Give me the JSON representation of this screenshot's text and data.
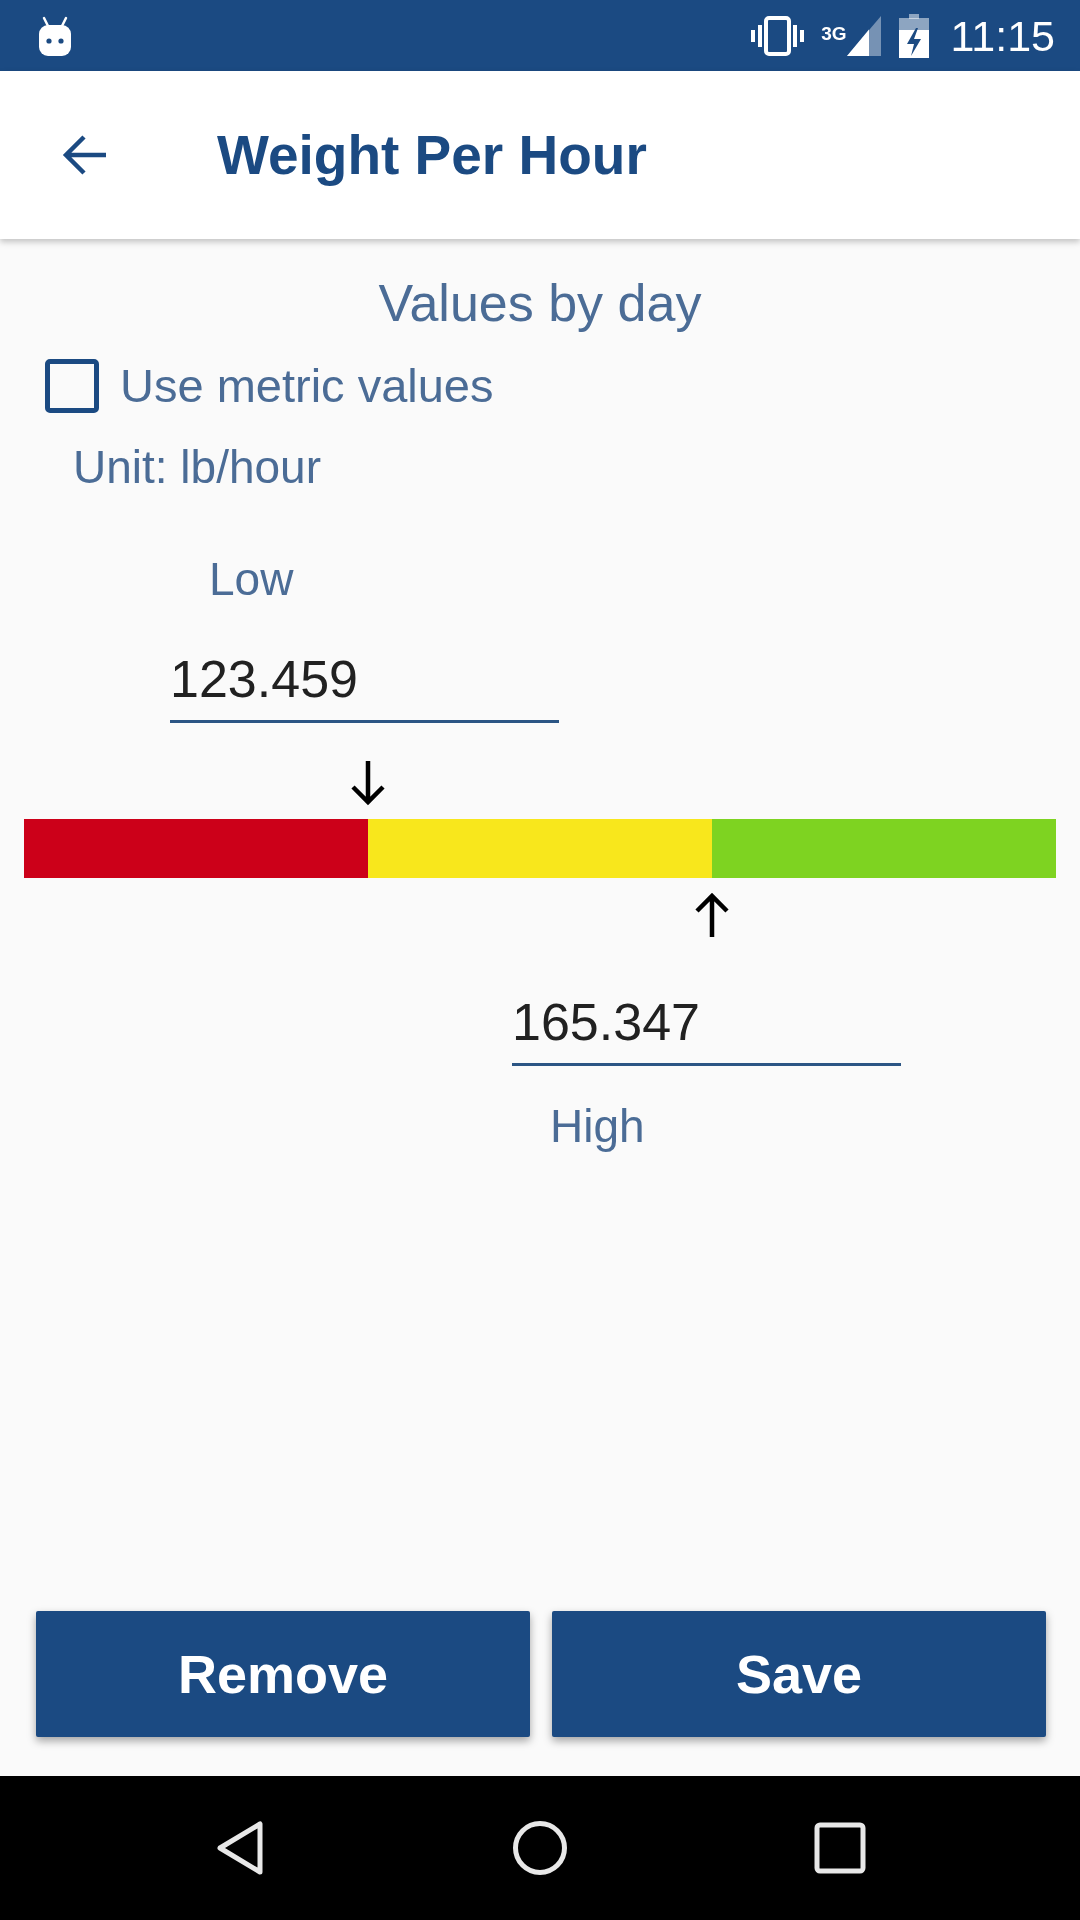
{
  "status_bar": {
    "network": "3G",
    "time": "11:15"
  },
  "app_bar": {
    "title": "Weight Per Hour"
  },
  "heading": "Values by day",
  "metric_checkbox": {
    "label": "Use metric values",
    "checked": false
  },
  "unit": "Unit: lb/hour",
  "low": {
    "label": "Low",
    "value": "123.459"
  },
  "range_bar": {
    "segments": [
      {
        "color": "#cc0019"
      },
      {
        "color": "#f8e71c"
      },
      {
        "color": "#7ed321"
      }
    ],
    "markers": [
      {
        "kind": "down",
        "level": 0.3333
      },
      {
        "kind": "up",
        "level": 0.6667
      }
    ]
  },
  "high": {
    "value": "165.347",
    "label": "High"
  },
  "buttons": [
    {
      "label": "Remove"
    },
    {
      "label": "Save"
    }
  ]
}
